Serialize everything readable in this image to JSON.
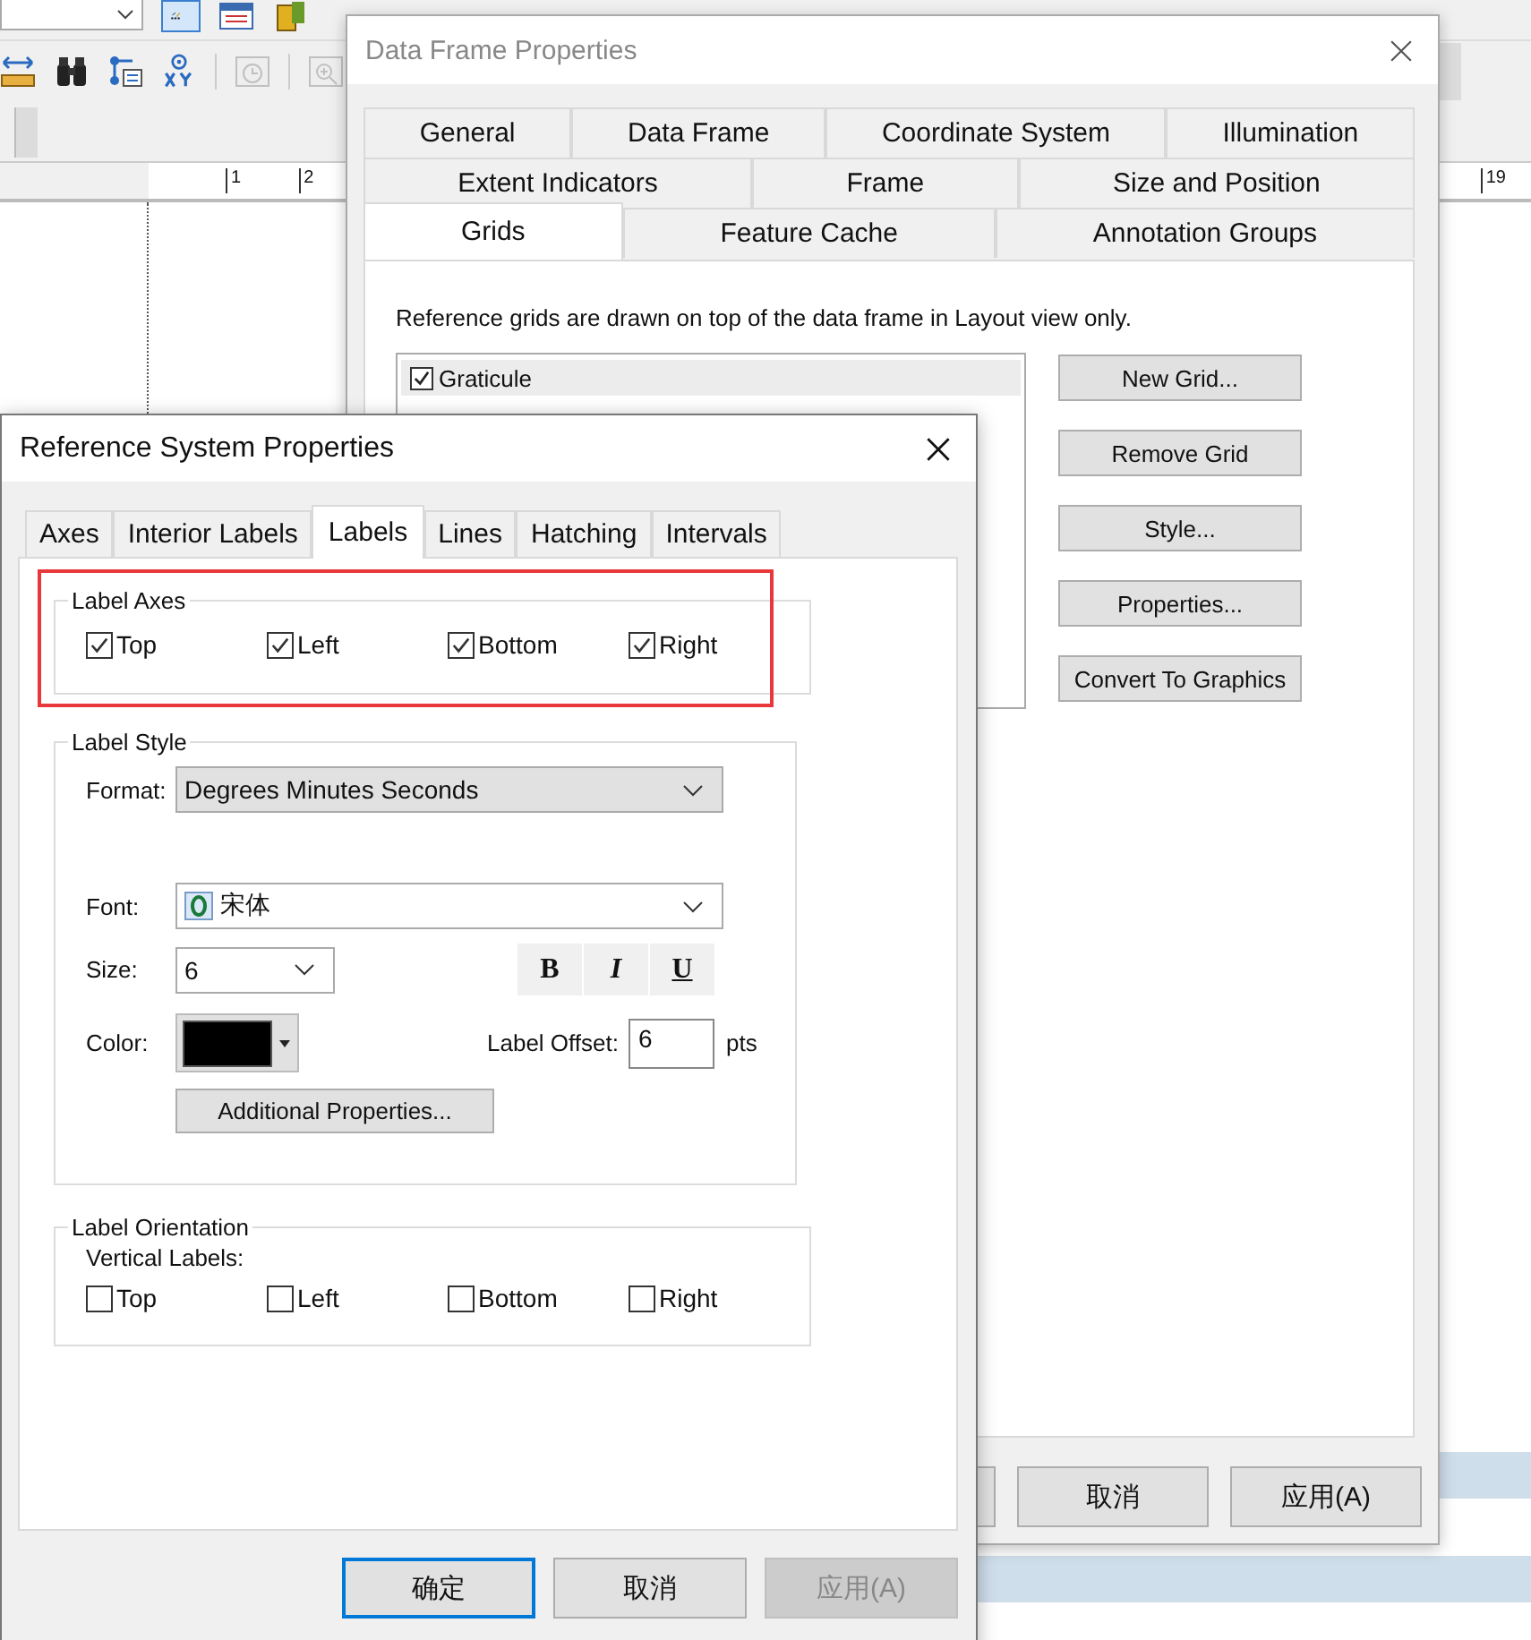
{
  "background": {
    "ruler_labels": [
      "1",
      "2"
    ],
    "ruler_right_label": "19"
  },
  "data_frame_window": {
    "title": "Data Frame Properties",
    "tab_rows": [
      [
        {
          "label": "General",
          "selected": false
        },
        {
          "label": "Data Frame",
          "selected": false
        },
        {
          "label": "Coordinate System",
          "selected": false
        },
        {
          "label": "Illumination",
          "selected": false
        }
      ],
      [
        {
          "label": "Extent Indicators",
          "selected": false
        },
        {
          "label": "Frame",
          "selected": false
        },
        {
          "label": "Size and Position",
          "selected": false
        }
      ],
      [
        {
          "label": "Grids",
          "selected": true
        },
        {
          "label": "Feature Cache",
          "selected": false
        },
        {
          "label": "Annotation Groups",
          "selected": false
        }
      ]
    ],
    "description": "Reference grids are drawn on top of the data frame in Layout view only.",
    "grids": [
      {
        "label": "Graticule",
        "checked": true,
        "selected": true
      }
    ],
    "side_buttons": [
      "New Grid...",
      "Remove Grid",
      "Style...",
      "Properties...",
      "Convert To Graphics"
    ],
    "footer_buttons": [
      "取消",
      "应用(A)"
    ]
  },
  "reference_window": {
    "title": "Reference System Properties",
    "tabs": [
      {
        "label": "Axes",
        "selected": false
      },
      {
        "label": "Interior Labels",
        "selected": false
      },
      {
        "label": "Labels",
        "selected": true
      },
      {
        "label": "Lines",
        "selected": false
      },
      {
        "label": "Hatching",
        "selected": false
      },
      {
        "label": "Intervals",
        "selected": false
      }
    ],
    "label_axes": {
      "title": "Label Axes",
      "highlighted": true,
      "items": [
        {
          "label": "Top",
          "checked": true
        },
        {
          "label": "Left",
          "checked": true
        },
        {
          "label": "Bottom",
          "checked": true
        },
        {
          "label": "Right",
          "checked": true
        }
      ]
    },
    "label_style": {
      "title": "Label Style",
      "format_label": "Format:",
      "format_value": "Degrees Minutes Seconds",
      "font_label": "Font:",
      "font_value": "宋体",
      "size_label": "Size:",
      "size_value": "6",
      "style_buttons": [
        {
          "label": "B",
          "kind": "bold"
        },
        {
          "label": "I",
          "kind": "italic"
        },
        {
          "label": "U",
          "kind": "underline"
        }
      ],
      "color_label": "Color:",
      "color": "#000000",
      "offset_label": "Label Offset:",
      "offset_value": "6",
      "offset_unit": "pts",
      "additional_button": "Additional Properties..."
    },
    "label_orientation": {
      "title": "Label Orientation",
      "subtitle": "Vertical Labels:",
      "items": [
        {
          "label": "Top",
          "checked": false
        },
        {
          "label": "Left",
          "checked": false
        },
        {
          "label": "Bottom",
          "checked": false
        },
        {
          "label": "Right",
          "checked": false
        }
      ]
    },
    "buttons": [
      {
        "label": "确定",
        "kind": "default"
      },
      {
        "label": "取消",
        "kind": "normal"
      },
      {
        "label": "应用(A)",
        "kind": "disabled"
      }
    ]
  }
}
